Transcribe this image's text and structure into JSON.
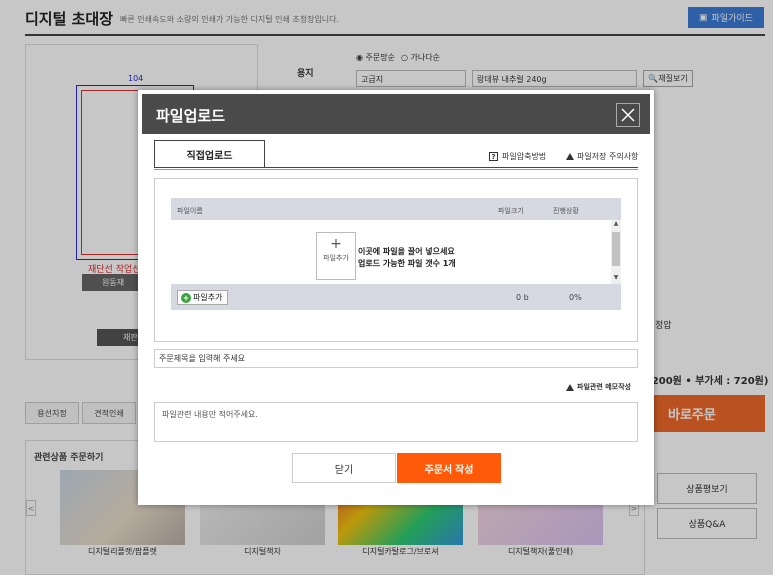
{
  "page": {
    "title": "디지털 초대장",
    "subtitle": "빠른 인쇄속도와 소량의 인쇄가 가능한 디지털 인쇄 초청장입니다.",
    "guide_button": "파일가이드",
    "preview": {
      "width_label": "104",
      "cutline_label": "재단선 작업선",
      "upload_button": "원동재",
      "view_button": "재판"
    },
    "options": {
      "paper_label": "용지",
      "radio_1": "주문망순",
      "radio_2": "가나다순",
      "select_1": "고급지",
      "select_2": "랑데뷰 내추럴 240g",
      "paper_view_button": "재질보기"
    },
    "partial_text": "정압",
    "price_text": ",200원 • 부가세 : 720원)",
    "order_now_button": "바로주문",
    "tabs": [
      "용선지정",
      "견적인쇄"
    ],
    "related": {
      "title": "관련상품 주문하기",
      "products": [
        "디지털리플렛/팜플렛",
        "디지털책자",
        "디지털카탈로그/브로셔",
        "디지털책자(풀인쇄)"
      ],
      "prev": "<",
      "next": ">"
    },
    "side_buttons": [
      "상품평보기",
      "상품Q&A"
    ]
  },
  "modal": {
    "title": "파일업로드",
    "tab_direct": "직접업로드",
    "help_link": "파일압축방법",
    "help_icon_glyph": "?",
    "warn_link": "파일저장 주의사항",
    "table": {
      "col_name": "파일이름",
      "col_size": "파일크기",
      "col_status": "진행상황",
      "drop_icon_label": "파일추가",
      "drop_line1": "이곳에 파일을 끌어 넣으세요",
      "drop_line2": "업로드 가능한 파일 갯수 1개",
      "add_button": "파일추가",
      "total_size": "0 b",
      "progress": "0%"
    },
    "title_input_value": "주문제목을 입력해 주세요",
    "memo_label": "파일관련 메모작성",
    "memo_placeholder": "파일관련 내용만 적어주세요.",
    "close_button": "닫기",
    "submit_button": "주문서 작성"
  }
}
